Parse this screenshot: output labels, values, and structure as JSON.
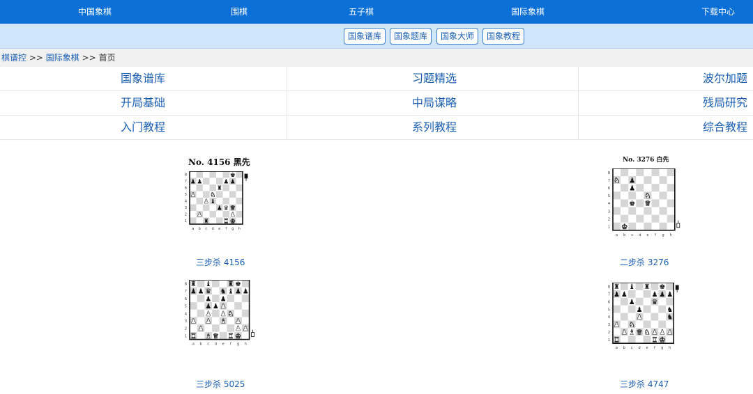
{
  "topnav": [
    "中国象棋",
    "围棋",
    "五子棋",
    "国际象棋",
    "下载中心"
  ],
  "subnav": [
    "国象谱库",
    "国象题库",
    "国象大师",
    "国象教程"
  ],
  "breadcrumb": {
    "site": "棋谱控",
    "sep1": ">>",
    "section": "国际象棋",
    "sep2": ">>",
    "current": "首页"
  },
  "menu": [
    [
      "国象谱库",
      "习题精选",
      "波尔加题"
    ],
    [
      "开局基础",
      "中局谋略",
      "残局研究"
    ],
    [
      "入门教程",
      "系列教程",
      "综合教程"
    ]
  ],
  "colors": {
    "nav": "#0a6fd6",
    "subnav": "#cfe6fb",
    "link": "#1a5fb4"
  },
  "files": [
    "a",
    "b",
    "c",
    "d",
    "e",
    "f",
    "g",
    "h"
  ],
  "ranks": [
    "8",
    "7",
    "6",
    "5",
    "4",
    "3",
    "2",
    "1"
  ],
  "puzzles": [
    {
      "id": "p1",
      "title": "No. 4156  黑先",
      "label": "三步杀   4156",
      "turn": "black",
      "pieces": [
        {
          "sq": "g8",
          "p": "k"
        },
        {
          "sq": "a7",
          "p": "p"
        },
        {
          "sq": "b7",
          "p": "p"
        },
        {
          "sq": "f7",
          "p": "p"
        },
        {
          "sq": "g7",
          "p": "p"
        },
        {
          "sq": "e6",
          "p": "r"
        },
        {
          "sq": "a5",
          "p": "P"
        },
        {
          "sq": "d5",
          "p": "N"
        },
        {
          "sq": "c4",
          "p": "P"
        },
        {
          "sq": "d4",
          "p": "b"
        },
        {
          "sq": "e3",
          "p": "p"
        },
        {
          "sq": "f3",
          "p": "q"
        },
        {
          "sq": "g3",
          "p": "Q"
        },
        {
          "sq": "b2",
          "p": "P"
        },
        {
          "sq": "g2",
          "p": "P"
        },
        {
          "sq": "c1",
          "p": "r"
        },
        {
          "sq": "f1",
          "p": "R"
        },
        {
          "sq": "g1",
          "p": "K"
        }
      ]
    },
    {
      "id": "p2",
      "title": "No. 3276  白先",
      "label": "二步杀   3276",
      "turn": "white",
      "pieces": [
        {
          "sq": "a7",
          "p": "N"
        },
        {
          "sq": "c7",
          "p": "p"
        },
        {
          "sq": "c6",
          "p": "p"
        },
        {
          "sq": "e5",
          "p": "N"
        },
        {
          "sq": "c4",
          "p": "k"
        },
        {
          "sq": "e4",
          "p": "Q"
        },
        {
          "sq": "b1",
          "p": "K"
        }
      ]
    },
    {
      "id": "p3",
      "title": "",
      "label": "三步杀   5025",
      "turn": "white",
      "pieces": [
        {
          "sq": "a8",
          "p": "r"
        },
        {
          "sq": "c8",
          "p": "b"
        },
        {
          "sq": "f8",
          "p": "r"
        },
        {
          "sq": "g8",
          "p": "k"
        },
        {
          "sq": "a7",
          "p": "p"
        },
        {
          "sq": "b7",
          "p": "p"
        },
        {
          "sq": "c7",
          "p": "q"
        },
        {
          "sq": "e7",
          "p": "n"
        },
        {
          "sq": "f7",
          "p": "b"
        },
        {
          "sq": "g7",
          "p": "p"
        },
        {
          "sq": "h7",
          "p": "p"
        },
        {
          "sq": "c6",
          "p": "p"
        },
        {
          "sq": "e6",
          "p": "p"
        },
        {
          "sq": "c5",
          "p": "p"
        },
        {
          "sq": "d5",
          "p": "p"
        },
        {
          "sq": "e5",
          "p": "P"
        },
        {
          "sq": "c4",
          "p": "P"
        },
        {
          "sq": "e4",
          "p": "P"
        },
        {
          "sq": "f4",
          "p": "N"
        },
        {
          "sq": "a3",
          "p": "P"
        },
        {
          "sq": "c3",
          "p": "P"
        },
        {
          "sq": "e3",
          "p": "B"
        },
        {
          "sq": "g3",
          "p": "P"
        },
        {
          "sq": "b2",
          "p": "P"
        },
        {
          "sq": "g2",
          "p": "P"
        },
        {
          "sq": "h2",
          "p": "P"
        },
        {
          "sq": "a1",
          "p": "R"
        },
        {
          "sq": "c1",
          "p": "B"
        },
        {
          "sq": "d1",
          "p": "Q"
        },
        {
          "sq": "f1",
          "p": "R"
        },
        {
          "sq": "g1",
          "p": "K"
        }
      ]
    },
    {
      "id": "p4",
      "title": "",
      "label": "三步杀   4747",
      "turn": "black",
      "pieces": [
        {
          "sq": "a8",
          "p": "r"
        },
        {
          "sq": "c8",
          "p": "b"
        },
        {
          "sq": "e8",
          "p": "r"
        },
        {
          "sq": "g8",
          "p": "k"
        },
        {
          "sq": "a7",
          "p": "p"
        },
        {
          "sq": "b7",
          "p": "p"
        },
        {
          "sq": "f7",
          "p": "p"
        },
        {
          "sq": "g7",
          "p": "p"
        },
        {
          "sq": "h7",
          "p": "p"
        },
        {
          "sq": "c6",
          "p": "p"
        },
        {
          "sq": "f6",
          "p": "q"
        },
        {
          "sq": "d5",
          "p": "p"
        },
        {
          "sq": "h5",
          "p": "n"
        },
        {
          "sq": "d4",
          "p": "P"
        },
        {
          "sq": "h4",
          "p": "n"
        },
        {
          "sq": "a3",
          "p": "P"
        },
        {
          "sq": "c3",
          "p": "N"
        },
        {
          "sq": "b2",
          "p": "P"
        },
        {
          "sq": "c2",
          "p": "B"
        },
        {
          "sq": "d2",
          "p": "Q"
        },
        {
          "sq": "e2",
          "p": "N"
        },
        {
          "sq": "f2",
          "p": "P"
        },
        {
          "sq": "g2",
          "p": "P"
        },
        {
          "sq": "h2",
          "p": "P"
        },
        {
          "sq": "a1",
          "p": "R"
        },
        {
          "sq": "f1",
          "p": "R"
        },
        {
          "sq": "g1",
          "p": "K"
        }
      ]
    }
  ]
}
